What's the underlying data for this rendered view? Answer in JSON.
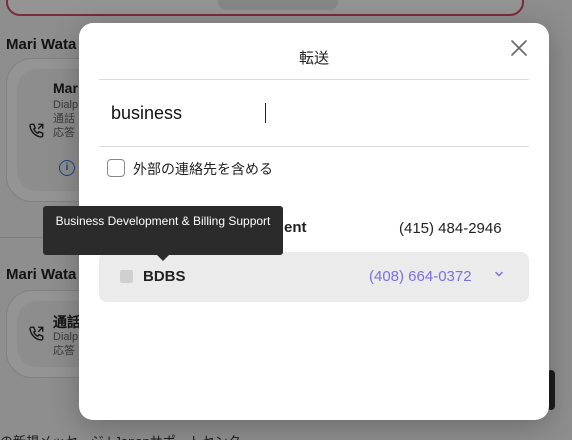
{
  "background": {
    "section_names": [
      "Mari Wata",
      "Mari Wata"
    ],
    "cards": [
      {
        "title": "Mar",
        "lines": [
          "Dialp",
          "通話",
          "応答"
        ]
      },
      {
        "title": "通話",
        "lines": [
          "Dialp",
          "応答"
        ]
      }
    ],
    "footer_text": "の新規メッセージ | Japanサポートセンター"
  },
  "modal": {
    "title": "転送",
    "search": {
      "value": "business",
      "placeholder": ""
    },
    "include_external_label": "外部の連絡先を含める",
    "partial_row": {
      "name": "ent",
      "phone": "(415) 484-2946"
    },
    "result": {
      "name": "BDBS",
      "phone": "(408) 664-0372"
    },
    "tooltip": "Business Development & Billing Support"
  },
  "colors": {
    "accent_phone": "#7b6ee6",
    "tooltip_bg": "#2b2b2b",
    "alert_border": "#d64a6a"
  }
}
